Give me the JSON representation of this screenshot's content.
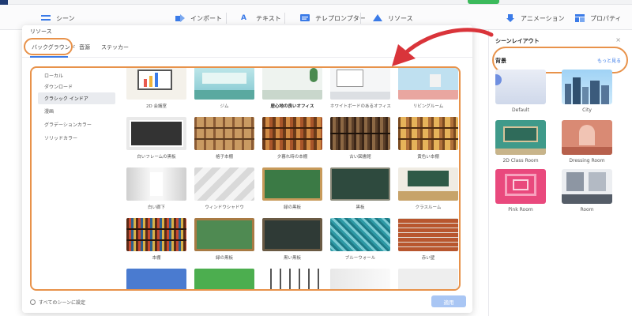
{
  "menubar": {
    "items": [
      {
        "label": "シーン",
        "icon": "list-icon"
      },
      {
        "label": "インポート",
        "icon": "import-icon"
      },
      {
        "label": "テキスト",
        "icon": "text-icon"
      },
      {
        "label": "テレプロンプター",
        "icon": "teleprompter-icon"
      },
      {
        "label": "リソース",
        "icon": "resource-icon"
      },
      {
        "label": "アニメーション",
        "icon": "animation-icon"
      },
      {
        "label": "プロパティ",
        "icon": "property-icon"
      }
    ]
  },
  "dialog": {
    "title": "リソース",
    "tabs": [
      "バックグラウンド",
      "音源",
      "ステッカー"
    ],
    "sidebar": [
      "ローカル",
      "ダウンロード",
      "クラシック インドア",
      "漫画",
      "グラデーションカラー",
      "ソリッドカラー"
    ],
    "active_sidebar": "クラシック インドア",
    "grid": [
      "2D 会議室",
      "ジム",
      "居心地の良いオフィス",
      "ホワイトボードのあるオフィス",
      "リビングルーム",
      "白いフレームの黒板",
      "格子本棚",
      "夕暮れ時の本棚",
      "古い図書館",
      "黄色い本棚",
      "白い廊下",
      "ウィンドウシャドウ",
      "緑の黒板",
      "黒板",
      "クラスルーム",
      "本棚",
      "緑の黒板",
      "黒い黒板",
      "ブルーウォール",
      "赤い壁"
    ],
    "footer": {
      "apply_all": "すべてのシーンに設定",
      "apply_button": "適用"
    }
  },
  "right_panel": {
    "title": "シーンレイアウト",
    "close": "×",
    "category": "背景",
    "more": "もっと見る",
    "layouts": [
      "Default",
      "City",
      "2D Class Room",
      "Dressing Room",
      "Pink Room",
      "Room"
    ]
  },
  "colors": {
    "highlight_orange": "#e8924a",
    "accent_blue": "#3b7be8",
    "arrow_red": "#d9343a"
  }
}
